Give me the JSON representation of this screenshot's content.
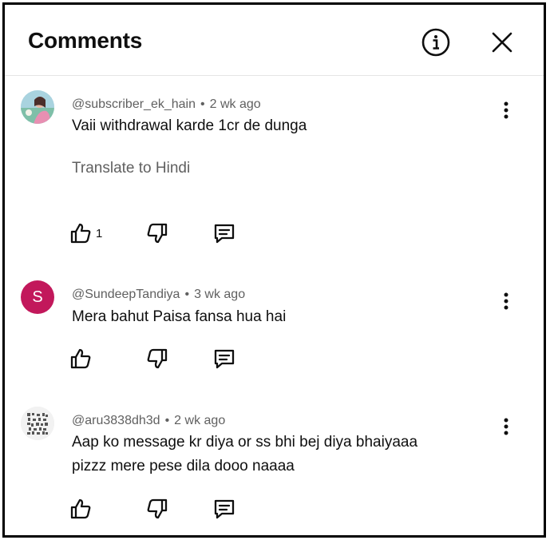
{
  "header": {
    "title": "Comments"
  },
  "comments": [
    {
      "handle": "@subscriber_ek_hain",
      "separator": "•",
      "time": "2 wk ago",
      "lines": [
        "Vaii withdrawal karde 1cr de dunga"
      ],
      "translate": "Translate to Hindi",
      "like_count": "1",
      "avatar_letter": ""
    },
    {
      "handle": "@SundeepTandiya",
      "separator": "•",
      "time": "3 wk ago",
      "lines": [
        "Mera bahut Paisa fansa hua hai"
      ],
      "avatar_letter": "S",
      "avatar_color": "#c2185b"
    },
    {
      "handle": "@aru3838dh3d",
      "separator": "•",
      "time": "2 wk ago",
      "lines": [
        "Aap ko message kr diya or ss bhi bej diya bhaiyaaa",
        "pizzz mere pese dila dooo naaaa"
      ],
      "avatar_letter": ""
    }
  ],
  "icons": {
    "info": "info-icon",
    "close": "close-icon",
    "more": "more-vertical-icon",
    "like": "thumb-up-icon",
    "dislike": "thumb-down-icon",
    "reply": "reply-icon"
  }
}
